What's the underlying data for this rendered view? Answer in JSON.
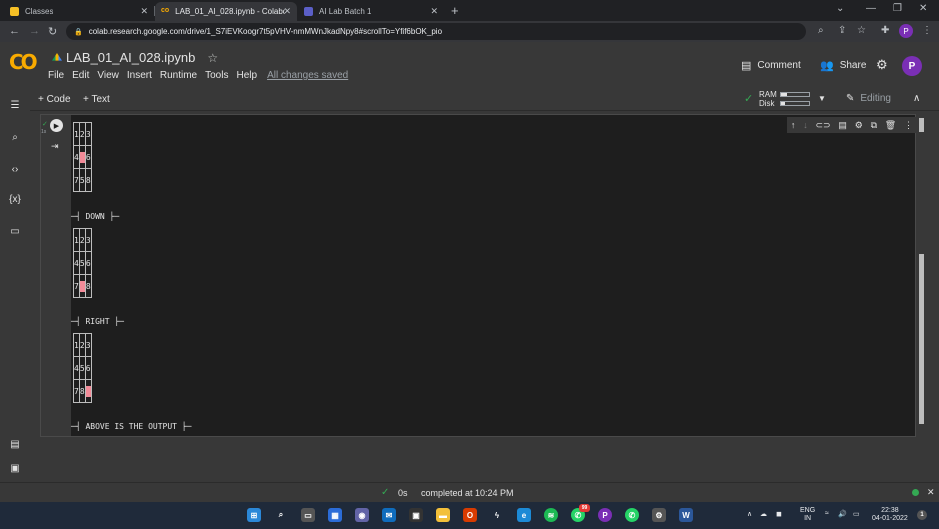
{
  "browser": {
    "tabs": [
      {
        "label": "Classes",
        "icon": "google-classroom-icon",
        "color": "#f6c026",
        "active": false
      },
      {
        "label": "LAB_01_AI_028.ipynb - Colaborat",
        "icon": "colab-icon",
        "color": "#f9ab00",
        "active": true
      },
      {
        "label": "AI Lab Batch 1",
        "icon": "teams-icon",
        "color": "#5b5fc7",
        "active": false
      }
    ],
    "new_tab": "+",
    "url": "colab.research.google.com/drive/1_S7iEVKoogr7t5pVHV-nmMWnJkadNpy8#scrollTo=Yfif6bOK_pio",
    "profile_initial": "P"
  },
  "colab": {
    "logo": "CO",
    "notebook_title": "LAB_01_AI_028.ipynb",
    "menu": [
      "File",
      "Edit",
      "View",
      "Insert",
      "Runtime",
      "Tools",
      "Help"
    ],
    "save_status": "All changes saved",
    "comment_label": "Comment",
    "share_label": "Share",
    "avatar_initial": "P",
    "add_code": "+ Code",
    "add_text": "+ Text",
    "ram_label": "RAM",
    "disk_label": "Disk",
    "ram_usage": 0.2,
    "disk_usage": 0.15,
    "editing_label": "Editing"
  },
  "cell": {
    "exec_count": "1s",
    "output": {
      "top_grid": [
        [
          "1",
          "2",
          "3"
        ],
        [
          "4",
          "",
          "6"
        ],
        [
          "7",
          "5",
          "8"
        ]
      ],
      "down_label": "─┤ DOWN ├─",
      "down_grid": [
        [
          "1",
          "2",
          "3"
        ],
        [
          "4",
          "5",
          "6"
        ],
        [
          "7",
          "",
          "8"
        ]
      ],
      "right_label": "─┤ RIGHT ├─",
      "right_grid": [
        [
          "1",
          "2",
          "3"
        ],
        [
          "4",
          "5",
          "6"
        ],
        [
          "7",
          "8",
          ""
        ]
      ],
      "footer_label": "─┤ ABOVE IS THE OUTPUT ├─"
    }
  },
  "status": {
    "elapsed": "0s",
    "completed": "completed at 10:24 PM"
  },
  "taskbar": {
    "lang_top": "ENG",
    "lang_bottom": "IN",
    "time": "22:38",
    "date": "04-01-2022",
    "badge_count": "99",
    "notification_count": "1"
  },
  "colors": {
    "accent_orange": "#f9ab00",
    "blank_tile": "#f28b98",
    "success_green": "#34a853"
  }
}
